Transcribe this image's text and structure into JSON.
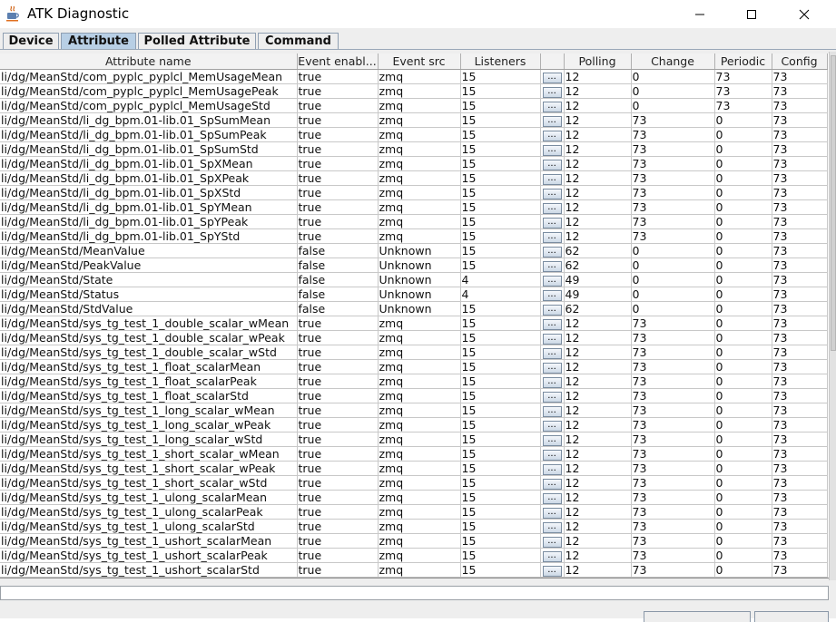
{
  "window": {
    "title": "ATK Diagnostic",
    "minimize": "—",
    "maximize": "☐",
    "close": "✕",
    "icon": "java-cup-icon"
  },
  "tabs": [
    {
      "label": "Device",
      "active": false
    },
    {
      "label": "Attribute",
      "active": true
    },
    {
      "label": "Polled Attribute",
      "active": false
    },
    {
      "label": "Command",
      "active": false
    }
  ],
  "table": {
    "columns": [
      "Attribute name",
      "Event enabl...",
      "Event src",
      "Listeners",
      "",
      "Polling",
      "Change",
      "Periodic",
      "Config"
    ],
    "button_label": "...",
    "rows": [
      [
        "li/dg/MeanStd/com_pyplc_pyplcl_MemUsageMean",
        "true",
        "zmq",
        "15",
        "12",
        "0",
        "73",
        "73"
      ],
      [
        "li/dg/MeanStd/com_pyplc_pyplcl_MemUsagePeak",
        "true",
        "zmq",
        "15",
        "12",
        "0",
        "73",
        "73"
      ],
      [
        "li/dg/MeanStd/com_pyplc_pyplcl_MemUsageStd",
        "true",
        "zmq",
        "15",
        "12",
        "0",
        "73",
        "73"
      ],
      [
        "li/dg/MeanStd/li_dg_bpm.01-lib.01_SpSumMean",
        "true",
        "zmq",
        "15",
        "12",
        "73",
        "0",
        "73"
      ],
      [
        "li/dg/MeanStd/li_dg_bpm.01-lib.01_SpSumPeak",
        "true",
        "zmq",
        "15",
        "12",
        "73",
        "0",
        "73"
      ],
      [
        "li/dg/MeanStd/li_dg_bpm.01-lib.01_SpSumStd",
        "true",
        "zmq",
        "15",
        "12",
        "73",
        "0",
        "73"
      ],
      [
        "li/dg/MeanStd/li_dg_bpm.01-lib.01_SpXMean",
        "true",
        "zmq",
        "15",
        "12",
        "73",
        "0",
        "73"
      ],
      [
        "li/dg/MeanStd/li_dg_bpm.01-lib.01_SpXPeak",
        "true",
        "zmq",
        "15",
        "12",
        "73",
        "0",
        "73"
      ],
      [
        "li/dg/MeanStd/li_dg_bpm.01-lib.01_SpXStd",
        "true",
        "zmq",
        "15",
        "12",
        "73",
        "0",
        "73"
      ],
      [
        "li/dg/MeanStd/li_dg_bpm.01-lib.01_SpYMean",
        "true",
        "zmq",
        "15",
        "12",
        "73",
        "0",
        "73"
      ],
      [
        "li/dg/MeanStd/li_dg_bpm.01-lib.01_SpYPeak",
        "true",
        "zmq",
        "15",
        "12",
        "73",
        "0",
        "73"
      ],
      [
        "li/dg/MeanStd/li_dg_bpm.01-lib.01_SpYStd",
        "true",
        "zmq",
        "15",
        "12",
        "73",
        "0",
        "73"
      ],
      [
        "li/dg/MeanStd/MeanValue",
        "false",
        "Unknown",
        "15",
        "62",
        "0",
        "0",
        "73"
      ],
      [
        "li/dg/MeanStd/PeakValue",
        "false",
        "Unknown",
        "15",
        "62",
        "0",
        "0",
        "73"
      ],
      [
        "li/dg/MeanStd/State",
        "false",
        "Unknown",
        "4",
        "49",
        "0",
        "0",
        "73"
      ],
      [
        "li/dg/MeanStd/Status",
        "false",
        "Unknown",
        "4",
        "49",
        "0",
        "0",
        "73"
      ],
      [
        "li/dg/MeanStd/StdValue",
        "false",
        "Unknown",
        "15",
        "62",
        "0",
        "0",
        "73"
      ],
      [
        "li/dg/MeanStd/sys_tg_test_1_double_scalar_wMean",
        "true",
        "zmq",
        "15",
        "12",
        "73",
        "0",
        "73"
      ],
      [
        "li/dg/MeanStd/sys_tg_test_1_double_scalar_wPeak",
        "true",
        "zmq",
        "15",
        "12",
        "73",
        "0",
        "73"
      ],
      [
        "li/dg/MeanStd/sys_tg_test_1_double_scalar_wStd",
        "true",
        "zmq",
        "15",
        "12",
        "73",
        "0",
        "73"
      ],
      [
        "li/dg/MeanStd/sys_tg_test_1_float_scalarMean",
        "true",
        "zmq",
        "15",
        "12",
        "73",
        "0",
        "73"
      ],
      [
        "li/dg/MeanStd/sys_tg_test_1_float_scalarPeak",
        "true",
        "zmq",
        "15",
        "12",
        "73",
        "0",
        "73"
      ],
      [
        "li/dg/MeanStd/sys_tg_test_1_float_scalarStd",
        "true",
        "zmq",
        "15",
        "12",
        "73",
        "0",
        "73"
      ],
      [
        "li/dg/MeanStd/sys_tg_test_1_long_scalar_wMean",
        "true",
        "zmq",
        "15",
        "12",
        "73",
        "0",
        "73"
      ],
      [
        "li/dg/MeanStd/sys_tg_test_1_long_scalar_wPeak",
        "true",
        "zmq",
        "15",
        "12",
        "73",
        "0",
        "73"
      ],
      [
        "li/dg/MeanStd/sys_tg_test_1_long_scalar_wStd",
        "true",
        "zmq",
        "15",
        "12",
        "73",
        "0",
        "73"
      ],
      [
        "li/dg/MeanStd/sys_tg_test_1_short_scalar_wMean",
        "true",
        "zmq",
        "15",
        "12",
        "73",
        "0",
        "73"
      ],
      [
        "li/dg/MeanStd/sys_tg_test_1_short_scalar_wPeak",
        "true",
        "zmq",
        "15",
        "12",
        "73",
        "0",
        "73"
      ],
      [
        "li/dg/MeanStd/sys_tg_test_1_short_scalar_wStd",
        "true",
        "zmq",
        "15",
        "12",
        "73",
        "0",
        "73"
      ],
      [
        "li/dg/MeanStd/sys_tg_test_1_ulong_scalarMean",
        "true",
        "zmq",
        "15",
        "12",
        "73",
        "0",
        "73"
      ],
      [
        "li/dg/MeanStd/sys_tg_test_1_ulong_scalarPeak",
        "true",
        "zmq",
        "15",
        "12",
        "73",
        "0",
        "73"
      ],
      [
        "li/dg/MeanStd/sys_tg_test_1_ulong_scalarStd",
        "true",
        "zmq",
        "15",
        "12",
        "73",
        "0",
        "73"
      ],
      [
        "li/dg/MeanStd/sys_tg_test_1_ushort_scalarMean",
        "true",
        "zmq",
        "15",
        "12",
        "73",
        "0",
        "73"
      ],
      [
        "li/dg/MeanStd/sys_tg_test_1_ushort_scalarPeak",
        "true",
        "zmq",
        "15",
        "12",
        "73",
        "0",
        "73"
      ],
      [
        "li/dg/MeanStd/sys_tg_test_1_ushort_scalarStd",
        "true",
        "zmq",
        "15",
        "12",
        "73",
        "0",
        "73"
      ]
    ]
  },
  "colors": {
    "active_tab": "#b8cfe5",
    "tab_background": "#eeeeee",
    "grid": "#c8c8c8"
  }
}
